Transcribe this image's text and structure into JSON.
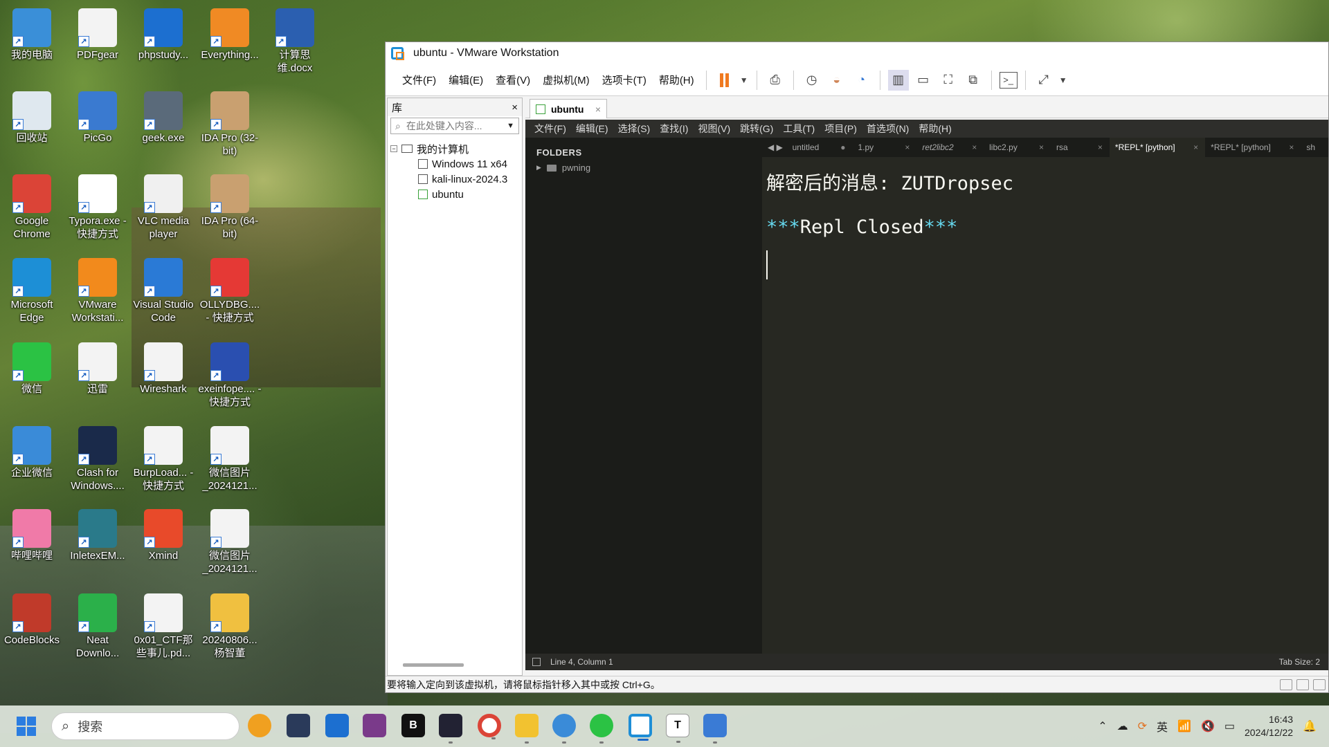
{
  "desktop": {
    "icons": [
      {
        "label": "我的电脑"
      },
      {
        "label": "PDFgear"
      },
      {
        "label": "phpstudy..."
      },
      {
        "label": "Everything..."
      },
      {
        "label": "计算思维.docx"
      },
      {
        "label": "回收站"
      },
      {
        "label": "PicGo"
      },
      {
        "label": "geek.exe"
      },
      {
        "label": "IDA Pro (32-bit)"
      },
      {
        "label": "Google Chrome"
      },
      {
        "label": "Typora.exe - 快捷方式"
      },
      {
        "label": "VLC media player"
      },
      {
        "label": "IDA Pro (64-bit)"
      },
      {
        "label": "Microsoft Edge"
      },
      {
        "label": "VMware Workstati..."
      },
      {
        "label": "Visual Studio Code"
      },
      {
        "label": "OLLYDBG.... - 快捷方式"
      },
      {
        "label": "微信"
      },
      {
        "label": "迅雷"
      },
      {
        "label": "Wireshark"
      },
      {
        "label": "exeinfope.... - 快捷方式"
      },
      {
        "label": "企业微信"
      },
      {
        "label": "Clash for Windows...."
      },
      {
        "label": "BurpLoad... - 快捷方式"
      },
      {
        "label": "微信图片_2024121..."
      },
      {
        "label": "哔哩哔哩"
      },
      {
        "label": "InletexEM..."
      },
      {
        "label": "Xmind"
      },
      {
        "label": "微信图片_2024121..."
      },
      {
        "label": "CodeBlocks"
      },
      {
        "label": "Neat Downlo..."
      },
      {
        "label": "0x01_CTF那些事儿.pd..."
      },
      {
        "label": "20240806... 杨智董"
      }
    ]
  },
  "vmware": {
    "title": "ubuntu - VMware Workstation",
    "menu": [
      "文件(F)",
      "编辑(E)",
      "查看(V)",
      "虚拟机(M)",
      "选项卡(T)",
      "帮助(H)"
    ],
    "library": {
      "title": "库",
      "close": "×",
      "search_placeholder": "在此处键入内容...",
      "root": "我的计算机",
      "vms": [
        "Windows 11 x64",
        "kali-linux-2024.3",
        "ubuntu"
      ]
    },
    "tab": {
      "label": "ubuntu",
      "close": "×"
    },
    "status_text": "要将输入定向到该虚拟机，请将鼠标指针移入其中或按 Ctrl+G。"
  },
  "sublime": {
    "menu": [
      "文件(F)",
      "编辑(E)",
      "选择(S)",
      "查找(I)",
      "视图(V)",
      "跳转(G)",
      "工具(T)",
      "项目(P)",
      "首选项(N)",
      "帮助(H)"
    ],
    "sidebar": {
      "header": "FOLDERS",
      "folder": "pwning"
    },
    "nav": "◀ ▶",
    "tabs": [
      {
        "label": "untitled",
        "close": "●"
      },
      {
        "label": "1.py",
        "close": "×"
      },
      {
        "label": "ret2libc2",
        "close": "×"
      },
      {
        "label": "libc2.py",
        "close": "×"
      },
      {
        "label": "rsa",
        "close": "×"
      },
      {
        "label": "*REPL* [python]",
        "close": "×"
      },
      {
        "label": "*REPL* [python]",
        "close": "×"
      },
      {
        "label": "sh",
        "close": ""
      }
    ],
    "editor": {
      "line1": "解密后的消息: ZUTDropsec",
      "line2_star_left": "***",
      "line2_text": "Repl Closed",
      "line2_star_right": "***"
    },
    "status": {
      "position": "Line 4, Column 1",
      "tab_size": "Tab Size: 2"
    }
  },
  "taskbar": {
    "search_placeholder": "搜索",
    "tray_lang": "英",
    "time": "16:43",
    "date": "2024/12/22"
  }
}
